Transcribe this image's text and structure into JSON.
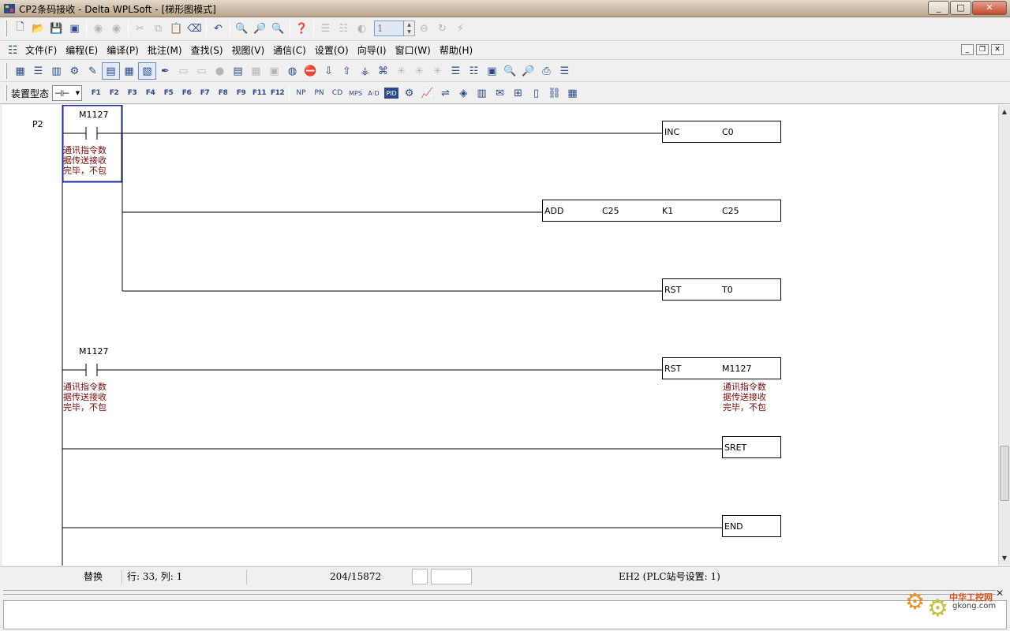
{
  "window": {
    "title": "CP2条码接收 - Delta WPLSoft - [梯形图模式]",
    "min": "_",
    "max": "□",
    "close": "✕"
  },
  "toolbar1": {
    "step_value": "1"
  },
  "menu": {
    "items": [
      "文件(F)",
      "编程(E)",
      "编译(P)",
      "批注(M)",
      "查找(S)",
      "视图(V)",
      "通信(C)",
      "设置(O)",
      "向导(I)",
      "窗口(W)",
      "帮助(H)"
    ],
    "mdi_min": "_",
    "mdi_restore": "❐",
    "mdi_close": "✕"
  },
  "toolbar3": {
    "device_label": "装置型态",
    "device_value": "⊣⊢",
    "function_keys": [
      "F1",
      "F2",
      "F3",
      "F4",
      "F5",
      "F6",
      "F7",
      "F8",
      "F9",
      "F11",
      "F12"
    ]
  },
  "ladder": {
    "pointer": "P2",
    "contact1": {
      "device": "M1127",
      "comment": [
        "通讯指令数",
        "据传送接收",
        "完毕，不包"
      ]
    },
    "contact2": {
      "device": "M1127",
      "comment": [
        "通讯指令数",
        "据传送接收",
        "完毕，不包"
      ]
    },
    "instr_inc": {
      "op": "INC",
      "arg1": "C0"
    },
    "instr_add": {
      "op": "ADD",
      "arg1": "C25",
      "arg2": "K1",
      "arg3": "C25"
    },
    "instr_rst1": {
      "op": "RST",
      "arg1": "T0"
    },
    "instr_rst2": {
      "op": "RST",
      "arg1": "M1127",
      "comment": [
        "通讯指令数",
        "据传送接收",
        "完毕，不包"
      ]
    },
    "instr_sret": {
      "op": "SRET"
    },
    "instr_end": {
      "op": "END"
    }
  },
  "status": {
    "mode": "替换",
    "position": "行: 33, 列: 1",
    "steps": "204/15872 Steps",
    "plc": "EH2 (PLC站号设置: 1)"
  },
  "watermark": {
    "brand": "中华工控网",
    "site": "gkong.com"
  }
}
